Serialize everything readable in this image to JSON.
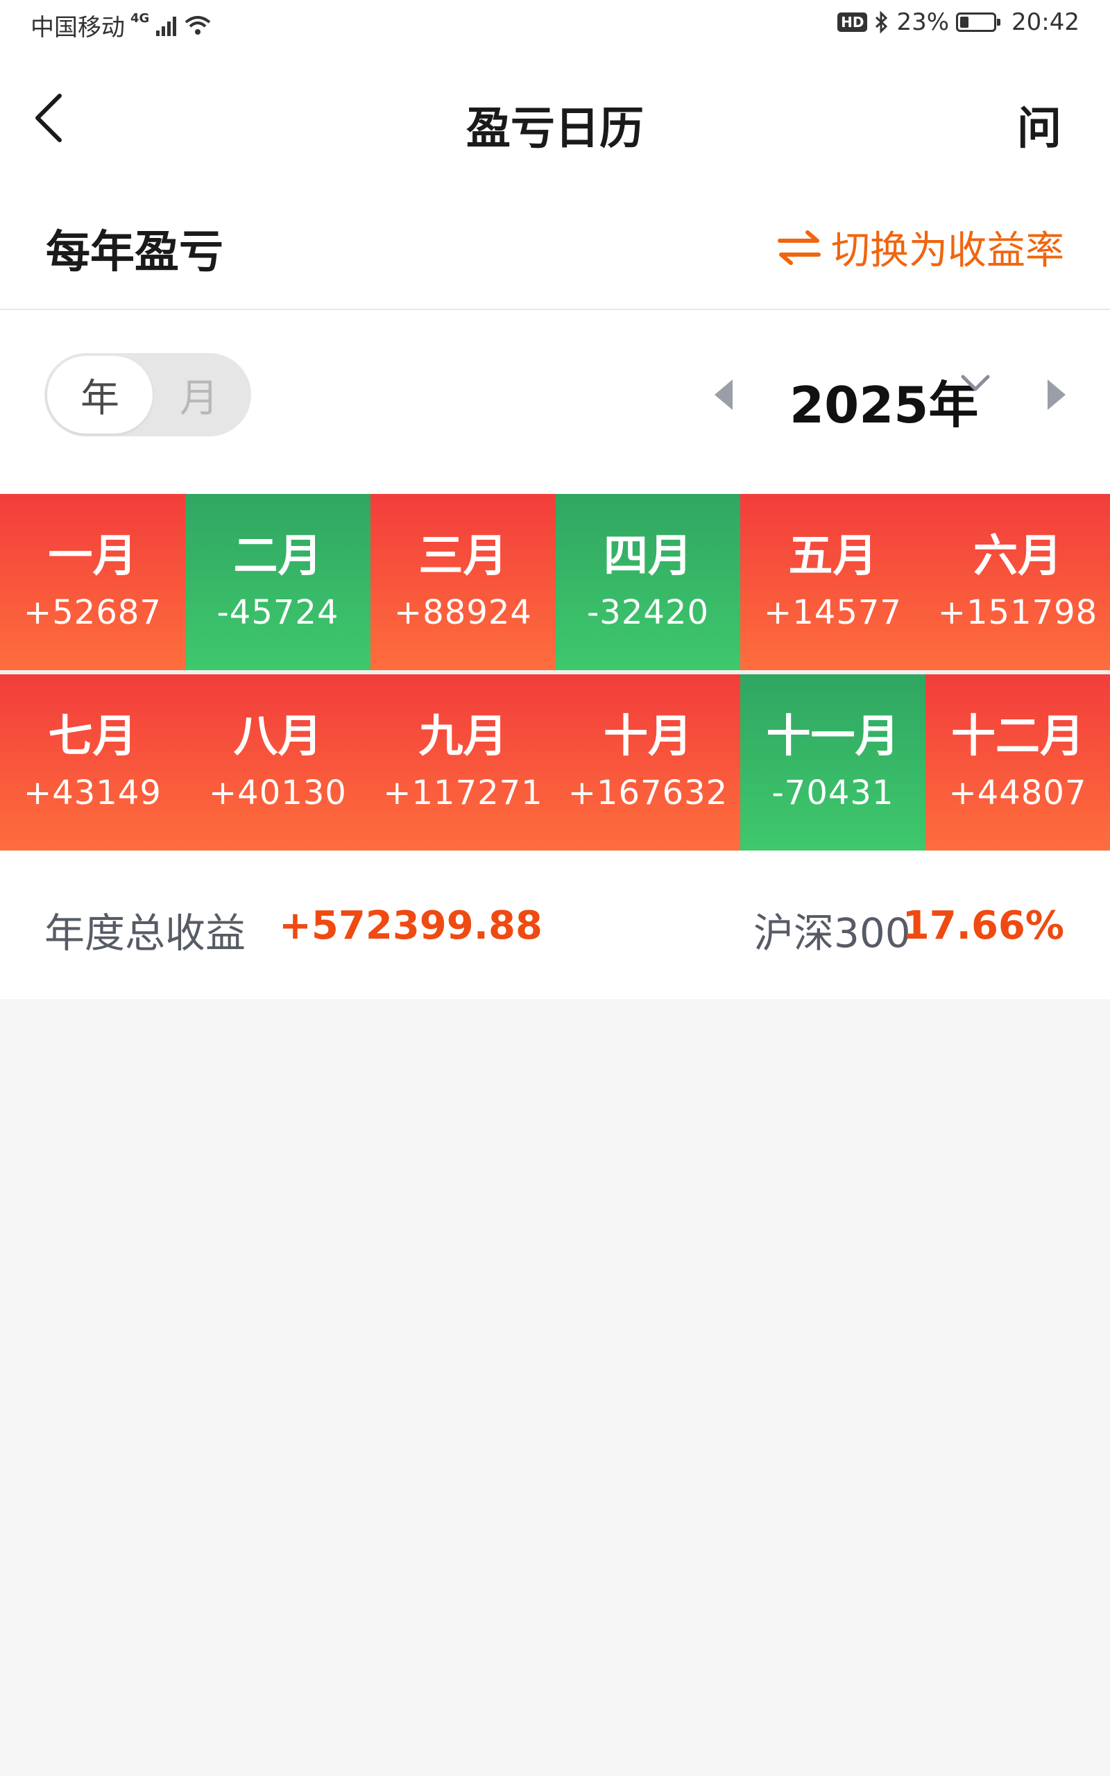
{
  "status_bar": {
    "carrier": "中国移动",
    "network": "4G",
    "hd_badge": "HD",
    "battery_percent": "23%",
    "battery_level": 0.23,
    "time": "20:42"
  },
  "nav": {
    "title": "盈亏日历",
    "help_label": "问"
  },
  "section": {
    "title": "每年盈亏",
    "switch_label": "切换为收益率",
    "accent_color": "#f0650f"
  },
  "period_toggle": {
    "year_label": "年",
    "month_label": "月",
    "selected": "年"
  },
  "year_selector": {
    "value": "2025年"
  },
  "months": [
    {
      "name": "一月",
      "value": "+52687",
      "status": "profit"
    },
    {
      "name": "二月",
      "value": "-45724",
      "status": "loss"
    },
    {
      "name": "三月",
      "value": "+88924",
      "status": "profit"
    },
    {
      "name": "四月",
      "value": "-32420",
      "status": "loss"
    },
    {
      "name": "五月",
      "value": "+14577",
      "status": "profit"
    },
    {
      "name": "六月",
      "value": "+151798",
      "status": "profit"
    },
    {
      "name": "七月",
      "value": "+43149",
      "status": "profit"
    },
    {
      "name": "八月",
      "value": "+40130",
      "status": "profit"
    },
    {
      "name": "九月",
      "value": "+117271",
      "status": "profit"
    },
    {
      "name": "十月",
      "value": "+167632",
      "status": "profit"
    },
    {
      "name": "十一月",
      "value": "-70431",
      "status": "loss"
    },
    {
      "name": "十二月",
      "value": "+44807",
      "status": "profit"
    }
  ],
  "colors": {
    "profit": "#f23d3b",
    "loss": "#30a662",
    "highlight": "#ee4a12"
  },
  "summary": {
    "total_label": "年度总收益",
    "total_value": "+572399.88",
    "index_label": "沪深300",
    "index_value": "17.66%"
  }
}
